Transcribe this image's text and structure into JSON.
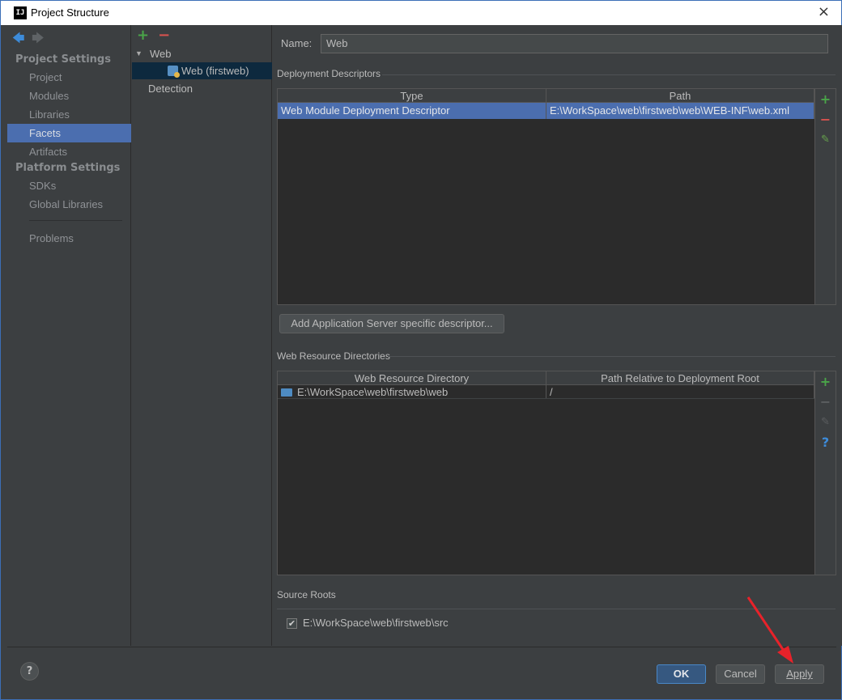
{
  "window": {
    "title": "Project Structure",
    "app_icon": "intellij-icon",
    "close": "×"
  },
  "sidebar": {
    "back": "back-arrow-icon",
    "forward": "forward-arrow-icon",
    "section_project": "Project Settings",
    "project_items": [
      "Project",
      "Modules",
      "Libraries",
      "Facets",
      "Artifacts"
    ],
    "section_platform": "Platform Settings",
    "platform_items": [
      "SDKs",
      "Global Libraries"
    ],
    "problems": "Problems",
    "selected": "Facets"
  },
  "tree": {
    "add": "+",
    "remove": "−",
    "group": "Web",
    "facet": "Web (firstweb)",
    "detection": "Detection"
  },
  "content": {
    "name_label": "Name:",
    "name_value": "Web",
    "deployment": {
      "title": "Deployment Descriptors",
      "columns": [
        "Type",
        "Path"
      ],
      "rows": [
        {
          "type": "Web Module Deployment Descriptor",
          "path": "E:\\WorkSpace\\web\\firstweb\\web\\WEB-INF\\web.xml"
        }
      ],
      "add_server_button": "Add Application Server specific descriptor..."
    },
    "resources": {
      "title": "Web Resource Directories",
      "columns": [
        "Web Resource Directory",
        "Path Relative to Deployment Root"
      ],
      "rows": [
        {
          "directory": "E:\\WorkSpace\\web\\firstweb\\web",
          "relative": "/"
        }
      ]
    },
    "source_roots": {
      "title": "Source Roots",
      "items": [
        {
          "path": "E:\\WorkSpace\\web\\firstweb\\src",
          "checked": true
        }
      ]
    }
  },
  "footer": {
    "help": "?",
    "ok": "OK",
    "cancel": "Cancel",
    "apply": "Apply"
  },
  "colors": {
    "selection": "#4b6eaf",
    "background": "#3c3f41",
    "annotation_arrow": "#e8222a"
  }
}
